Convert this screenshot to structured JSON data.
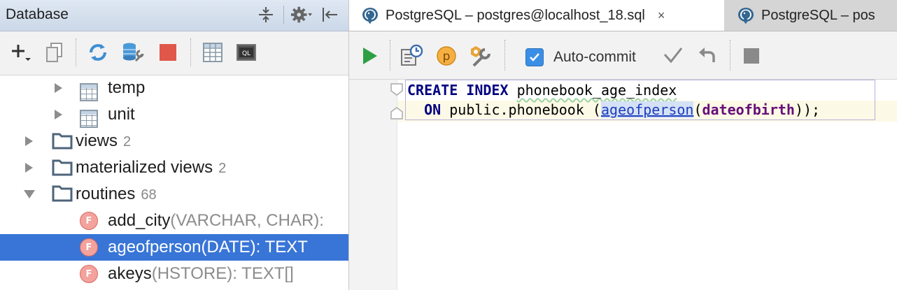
{
  "sidebar": {
    "title": "Database",
    "tree": [
      {
        "label": "temp",
        "icon": "table-icon",
        "arrow": "collapsed"
      },
      {
        "label": "unit",
        "icon": "table-icon",
        "arrow": "collapsed"
      },
      {
        "label": "views",
        "count": "2",
        "icon": "folder-icon",
        "arrow": "collapsed"
      },
      {
        "label": "materialized views",
        "count": "2",
        "icon": "folder-icon",
        "arrow": "collapsed"
      },
      {
        "label": "routines",
        "count": "68",
        "icon": "folder-icon",
        "arrow": "expanded"
      },
      {
        "name": "add_city",
        "signature": "(VARCHAR, CHAR):",
        "icon": "function-icon"
      },
      {
        "name": "ageofperson",
        "signature": "(DATE): TEXT",
        "icon": "function-icon",
        "selected": true
      },
      {
        "name": "akeys",
        "signature": "(HSTORE): TEXT[]",
        "icon": "function-icon"
      }
    ],
    "function_badge": "F"
  },
  "editor": {
    "tabs": [
      {
        "label": "PostgreSQL – postgres@localhost_18.sql",
        "active": true,
        "close": "×"
      },
      {
        "label": "PostgreSQL – pos",
        "active": false
      }
    ],
    "autocommit": {
      "label": "Auto-commit",
      "checked": true
    },
    "param_badge": "p",
    "code": {
      "line1": {
        "kw1": "CREATE",
        "kw2": "INDEX",
        "name": "phonebook_age_index"
      },
      "line2": {
        "kw": "ON",
        "target": "public.phonebook (",
        "func": "ageofperson",
        "open": "(",
        "param": "dateofbirth",
        "close": "));"
      }
    }
  },
  "colors": {
    "selection": "#3875d7",
    "keyword": "#000080",
    "accent_run": "#2ea043",
    "stop": "#e0574a"
  }
}
